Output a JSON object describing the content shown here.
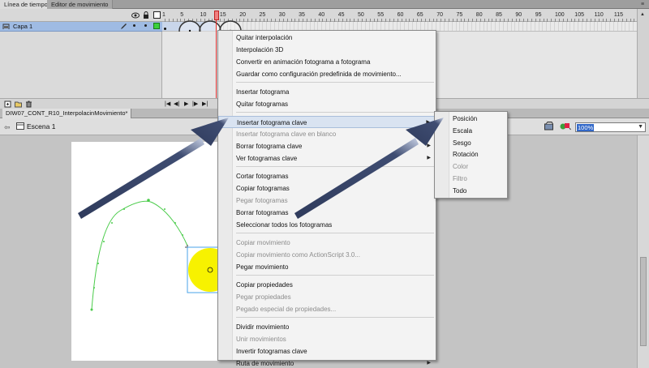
{
  "panel": {
    "tabs": [
      "Línea de tiempo",
      "Editor de movimiento"
    ],
    "menu_icon": "panel-menu-icon"
  },
  "timeline": {
    "frame_numbers": [
      "1",
      "5",
      "10",
      "15",
      "20",
      "25",
      "30",
      "35",
      "40",
      "45",
      "50",
      "55",
      "60",
      "65",
      "70",
      "75",
      "80",
      "85",
      "90",
      "95",
      "100",
      "105",
      "110",
      "115"
    ],
    "layer_name": "Capa 1",
    "header_icons": [
      "eye-icon",
      "lock-icon",
      "outline-icon"
    ],
    "footer_icons": [
      "new-layer-icon",
      "new-folder-icon",
      "delete-layer-icon"
    ],
    "playback_icons": [
      "go-first-icon",
      "step-back-icon",
      "play-icon",
      "step-forward-icon",
      "go-last-icon"
    ]
  },
  "document": {
    "tab_label": "DIW07_CONT_R10_InterpolacinMovimiento*",
    "scene_label": "Escena 1",
    "zoom": "100%",
    "colors": {
      "circle": "#f7f200",
      "path": "#4ccc4c",
      "selection": "#4aa3e8",
      "playhead": "#e03030"
    }
  },
  "context_menu": {
    "items": [
      {
        "label": "Quitar interpolación",
        "disabled": false
      },
      {
        "label": "Interpolación 3D",
        "disabled": false
      },
      {
        "label": "Convertir en animación fotograma a fotograma",
        "disabled": false
      },
      {
        "label": "Guardar como configuración predefinida de movimiento...",
        "disabled": false
      },
      {
        "label": "Insertar fotograma",
        "disabled": false
      },
      {
        "label": "Quitar fotogramas",
        "disabled": false
      },
      {
        "label": "Insertar fotograma clave",
        "disabled": false,
        "submenu": true,
        "highlighted": true
      },
      {
        "label": "Insertar fotograma clave en blanco",
        "disabled": true
      },
      {
        "label": "Borrar fotograma clave",
        "disabled": false,
        "submenu": true
      },
      {
        "label": "Ver fotogramas clave",
        "disabled": false,
        "submenu": true
      },
      {
        "label": "Cortar fotogramas",
        "disabled": false
      },
      {
        "label": "Copiar fotogramas",
        "disabled": false
      },
      {
        "label": "Pegar fotogramas",
        "disabled": true
      },
      {
        "label": "Borrar fotogramas",
        "disabled": false
      },
      {
        "label": "Seleccionar todos los fotogramas",
        "disabled": false
      },
      {
        "label": "Copiar movimiento",
        "disabled": true
      },
      {
        "label": "Copiar movimiento como ActionScript 3.0...",
        "disabled": true
      },
      {
        "label": "Pegar movimiento",
        "disabled": false
      },
      {
        "label": "Copiar propiedades",
        "disabled": false
      },
      {
        "label": "Pegar propiedades",
        "disabled": true
      },
      {
        "label": "Pegado especial de propiedades...",
        "disabled": true
      },
      {
        "label": "Dividir movimiento",
        "disabled": false
      },
      {
        "label": "Unir movimientos",
        "disabled": true
      },
      {
        "label": "Invertir fotogramas clave",
        "disabled": false
      },
      {
        "label": "Ruta de movimiento",
        "disabled": false,
        "submenu": true
      }
    ]
  },
  "submenu": {
    "items": [
      {
        "label": "Posición",
        "disabled": false
      },
      {
        "label": "Escala",
        "disabled": false
      },
      {
        "label": "Sesgo",
        "disabled": false
      },
      {
        "label": "Rotación",
        "disabled": false
      },
      {
        "label": "Color",
        "disabled": true
      },
      {
        "label": "Filtro",
        "disabled": true
      },
      {
        "label": "Todo",
        "disabled": false
      }
    ]
  }
}
